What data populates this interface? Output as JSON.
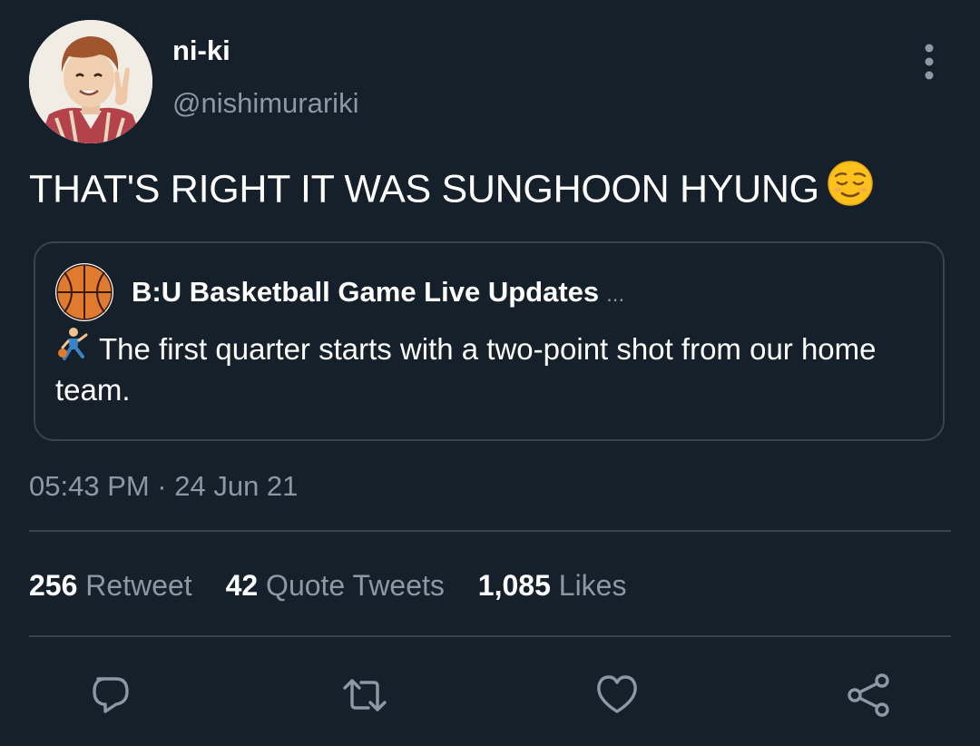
{
  "author": {
    "display_name": "ni-ki",
    "handle": "@nishimurariki",
    "avatar_icon": "profile-photo-peace-sign"
  },
  "tweet": {
    "text": "THAT'S RIGHT IT WAS SUNGHOON HYUNG",
    "emoji": "relieved-face-emoji",
    "timestamp": "05:43 PM · 24 Jun 21"
  },
  "quote": {
    "author_name": "B:U Basketball Game Live Updates",
    "truncation": "...",
    "avatar_icon": "basketball-icon",
    "emoji": "basketball-player-emoji",
    "text": "The first quarter starts with a two-point shot from our home team."
  },
  "stats": {
    "retweets": {
      "count": "256",
      "label": "Retweet"
    },
    "quotes": {
      "count": "42",
      "label": "Quote Tweets"
    },
    "likes": {
      "count": "1,085",
      "label": "Likes"
    }
  },
  "actions": [
    "reply-icon",
    "retweet-icon",
    "like-icon",
    "share-icon"
  ],
  "colors": {
    "background": "#15202b",
    "secondary_text": "#8b98a5",
    "border": "#38444d",
    "primary_text": "#ffffff"
  }
}
